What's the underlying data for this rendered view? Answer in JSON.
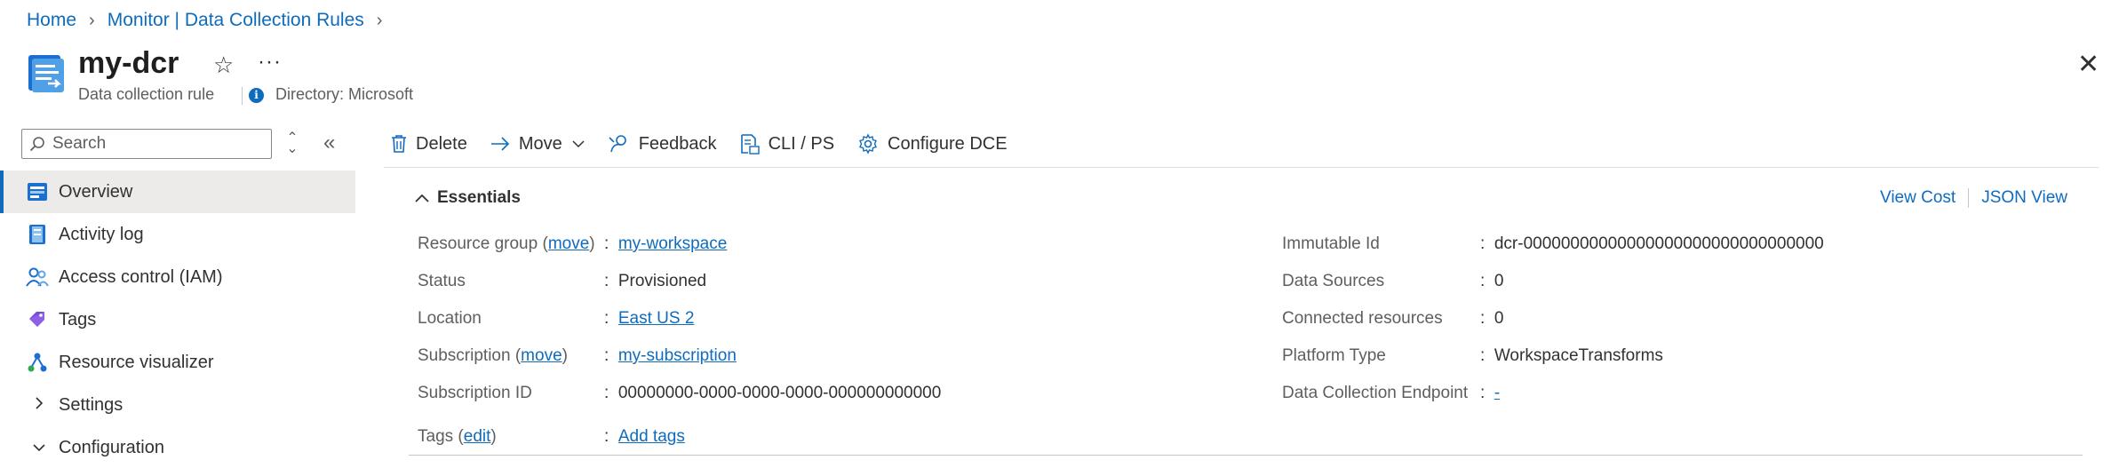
{
  "breadcrumb": {
    "home": "Home",
    "parent": "Monitor | Data Collection Rules"
  },
  "resource": {
    "title": "my-dcr",
    "type": "Data collection rule",
    "directory": "Directory: Microsoft"
  },
  "sidebar": {
    "search_placeholder": "Search",
    "items": [
      {
        "label": "Overview",
        "icon": "overview-icon",
        "active": true
      },
      {
        "label": "Activity log",
        "icon": "activity-log-icon"
      },
      {
        "label": "Access control (IAM)",
        "icon": "iam-people-icon"
      },
      {
        "label": "Tags",
        "icon": "tag-icon"
      },
      {
        "label": "Resource visualizer",
        "icon": "visualizer-icon"
      },
      {
        "label": "Settings",
        "icon": "chevron-right-icon"
      },
      {
        "label": "Configuration",
        "icon": "chevron-down-icon"
      }
    ]
  },
  "toolbar": {
    "delete": "Delete",
    "move": "Move",
    "feedback": "Feedback",
    "cli": "CLI / PS",
    "configure": "Configure DCE"
  },
  "essentials": {
    "heading": "Essentials",
    "view_cost": "View Cost",
    "json_view": "JSON View",
    "left": {
      "resource_group_label": "Resource group",
      "resource_group_action": "move",
      "resource_group_value": "my-workspace",
      "status_label": "Status",
      "status_value": "Provisioned",
      "location_label": "Location",
      "location_value": "East US 2",
      "subscription_label": "Subscription",
      "subscription_action": "move",
      "subscription_value": "my-subscription",
      "subscription_id_label": "Subscription ID",
      "subscription_id_value": "00000000-0000-0000-0000-000000000000",
      "tags_label": "Tags",
      "tags_action": "edit",
      "tags_value": "Add tags"
    },
    "right": {
      "immutable_id_label": "Immutable Id",
      "immutable_id_value": "dcr-00000000000000000000000000000000",
      "data_sources_label": "Data Sources",
      "data_sources_value": "0",
      "connected_label": "Connected resources",
      "connected_value": "0",
      "platform_label": "Platform Type",
      "platform_value": "WorkspaceTransforms",
      "dce_label": "Data Collection Endpoint",
      "dce_value": "-"
    }
  },
  "colors": {
    "accent": "#0f6cbd",
    "nav_active_bg": "#edebe9",
    "text": "#323130",
    "muted": "#605e5c"
  }
}
